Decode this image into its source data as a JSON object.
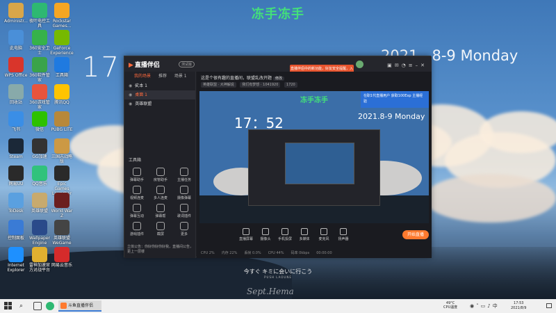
{
  "wallpaper": {
    "title": "冻手冻手",
    "time": "17：52",
    "date": "2021 . 8-9 Monday",
    "lyric": "今すぐ キミに会いに行こう",
    "lyric_sub": "PUSH LAOUNE",
    "signature": "Sept.Hema"
  },
  "desktop_icons": [
    {
      "label": "Administr...",
      "icon": "user-folder-icon",
      "color": "#d8a64a"
    },
    {
      "label": "夜叶电控工具",
      "icon": "green-app-icon",
      "color": "#2eb872"
    },
    {
      "label": "Rockstar Games...",
      "icon": "rockstar-icon",
      "color": "#f5a623"
    },
    {
      "label": "此电脑",
      "icon": "computer-icon",
      "color": "#4a8fd8"
    },
    {
      "label": "360安全卫士",
      "icon": "shield-360-icon",
      "color": "#36b24a"
    },
    {
      "label": "GeForce Experience",
      "icon": "nvidia-icon",
      "color": "#76b900"
    },
    {
      "label": "WPS Office",
      "icon": "wps-icon",
      "color": "#d9352b"
    },
    {
      "label": "360软件管家",
      "icon": "plus-360-icon",
      "color": "#3aa34a"
    },
    {
      "label": "工具箱",
      "icon": "blue-s-icon",
      "color": "#1f7ae0"
    },
    {
      "label": "回收站",
      "icon": "recycle-bin-icon",
      "color": "#8aa"
    },
    {
      "label": "360游戏管家",
      "icon": "colorful-360-icon",
      "color": "#e8543c"
    },
    {
      "label": "腾讯QQ",
      "icon": "qq-icon",
      "color": "#ffc400"
    },
    {
      "label": "飞书",
      "icon": "bird-icon",
      "color": "#3a8ee6"
    },
    {
      "label": "微信",
      "icon": "wechat-icon",
      "color": "#2dc100"
    },
    {
      "label": "PUBG LITE",
      "icon": "pubg-icon",
      "color": "#b7883a"
    },
    {
      "label": "Steam",
      "icon": "steam-icon",
      "color": "#1b2838"
    },
    {
      "label": "GG加速",
      "icon": "gg-icon",
      "color": "#333"
    },
    {
      "label": "三国志战略版",
      "icon": "game-icon",
      "color": "#c94"
    },
    {
      "label": "网易UU",
      "icon": "uu-icon",
      "color": "#2a2a2a"
    },
    {
      "label": "QQ音乐",
      "icon": "qq-music-icon",
      "color": "#31c27c"
    },
    {
      "label": "Epic Games Launcher",
      "icon": "epic-icon",
      "color": "#2a2a2a"
    },
    {
      "label": "ToDesk",
      "icon": "todesk-icon",
      "color": "#5aa0e0"
    },
    {
      "label": "英雄联盟",
      "icon": "lol-icon",
      "color": "#c8aa6e"
    },
    {
      "label": "World War Z",
      "icon": "wwz-icon",
      "color": "#6b1f1f"
    },
    {
      "label": "控制面板",
      "icon": "control-panel-icon",
      "color": "#3a7bd5"
    },
    {
      "label": "Wallpaper Engine",
      "icon": "wallpaper-engine-icon",
      "color": "#2a4a8a"
    },
    {
      "label": "英雄联盟 WeGame",
      "icon": "wegame-icon",
      "color": "#444"
    },
    {
      "label": "Internet Explorer",
      "icon": "ie-icon",
      "color": "#1e90ff"
    },
    {
      "label": "雷神加速官方对战平台",
      "icon": "leishen-icon",
      "color": "#e0b030"
    },
    {
      "label": "网易云音乐",
      "icon": "netease-music-icon",
      "color": "#d52b2b"
    }
  ],
  "app": {
    "name": "直播伴侣",
    "beta": "测试版",
    "notice": "直播伴侣中的新功能，好友安全提醒，入门啦",
    "tabs": [
      "我的场景",
      "推荐",
      "场景 1"
    ],
    "scenes": [
      "文本 1",
      "桌面 1",
      "英雄联盟"
    ],
    "toolbox_title": "工具箱",
    "tools": [
      "弹幕助手",
      "房管助手",
      "主播任务",
      "视频连麦",
      "多人连麦",
      "摄像弹幕",
      "弹幕互动",
      "弹幕帮",
      "歌词插件",
      "游戏插件",
      "截屏",
      "更多"
    ],
    "sidebar_footer": "立体公告：你好你好你好我，直播间公告，更上一层楼",
    "live_title": "这是个很有趣的直播间，联盟乱改开题",
    "live_title_tag": "修改",
    "tags": [
      "英雄联盟 · 大神解说",
      "我们有梦想 · 1041920",
      "1720"
    ],
    "promo_text": "在职1代直播用户\n获取100Exp 主播经验",
    "bottom_buttons": [
      "直播屏幕",
      "摄像头",
      "手机投屏",
      "多媒体",
      "麦克风",
      "扬声器"
    ],
    "start_button": "开始直播",
    "status": [
      "CPU 2%",
      "内存 22%",
      "丢帧 0.0%",
      "CPU 44%",
      "码率 0kbps",
      "00:00:00"
    ]
  },
  "preview": {
    "title": "冻手冻手",
    "time": "17：52",
    "date": "2021.8-9 Monday"
  },
  "taskbar": {
    "app_label": "斗鱼直播伴侣",
    "weather_temp": "49°C",
    "weather_label": "CPU温度",
    "clock_time": "17:53",
    "clock_date": "2021/8/9"
  }
}
